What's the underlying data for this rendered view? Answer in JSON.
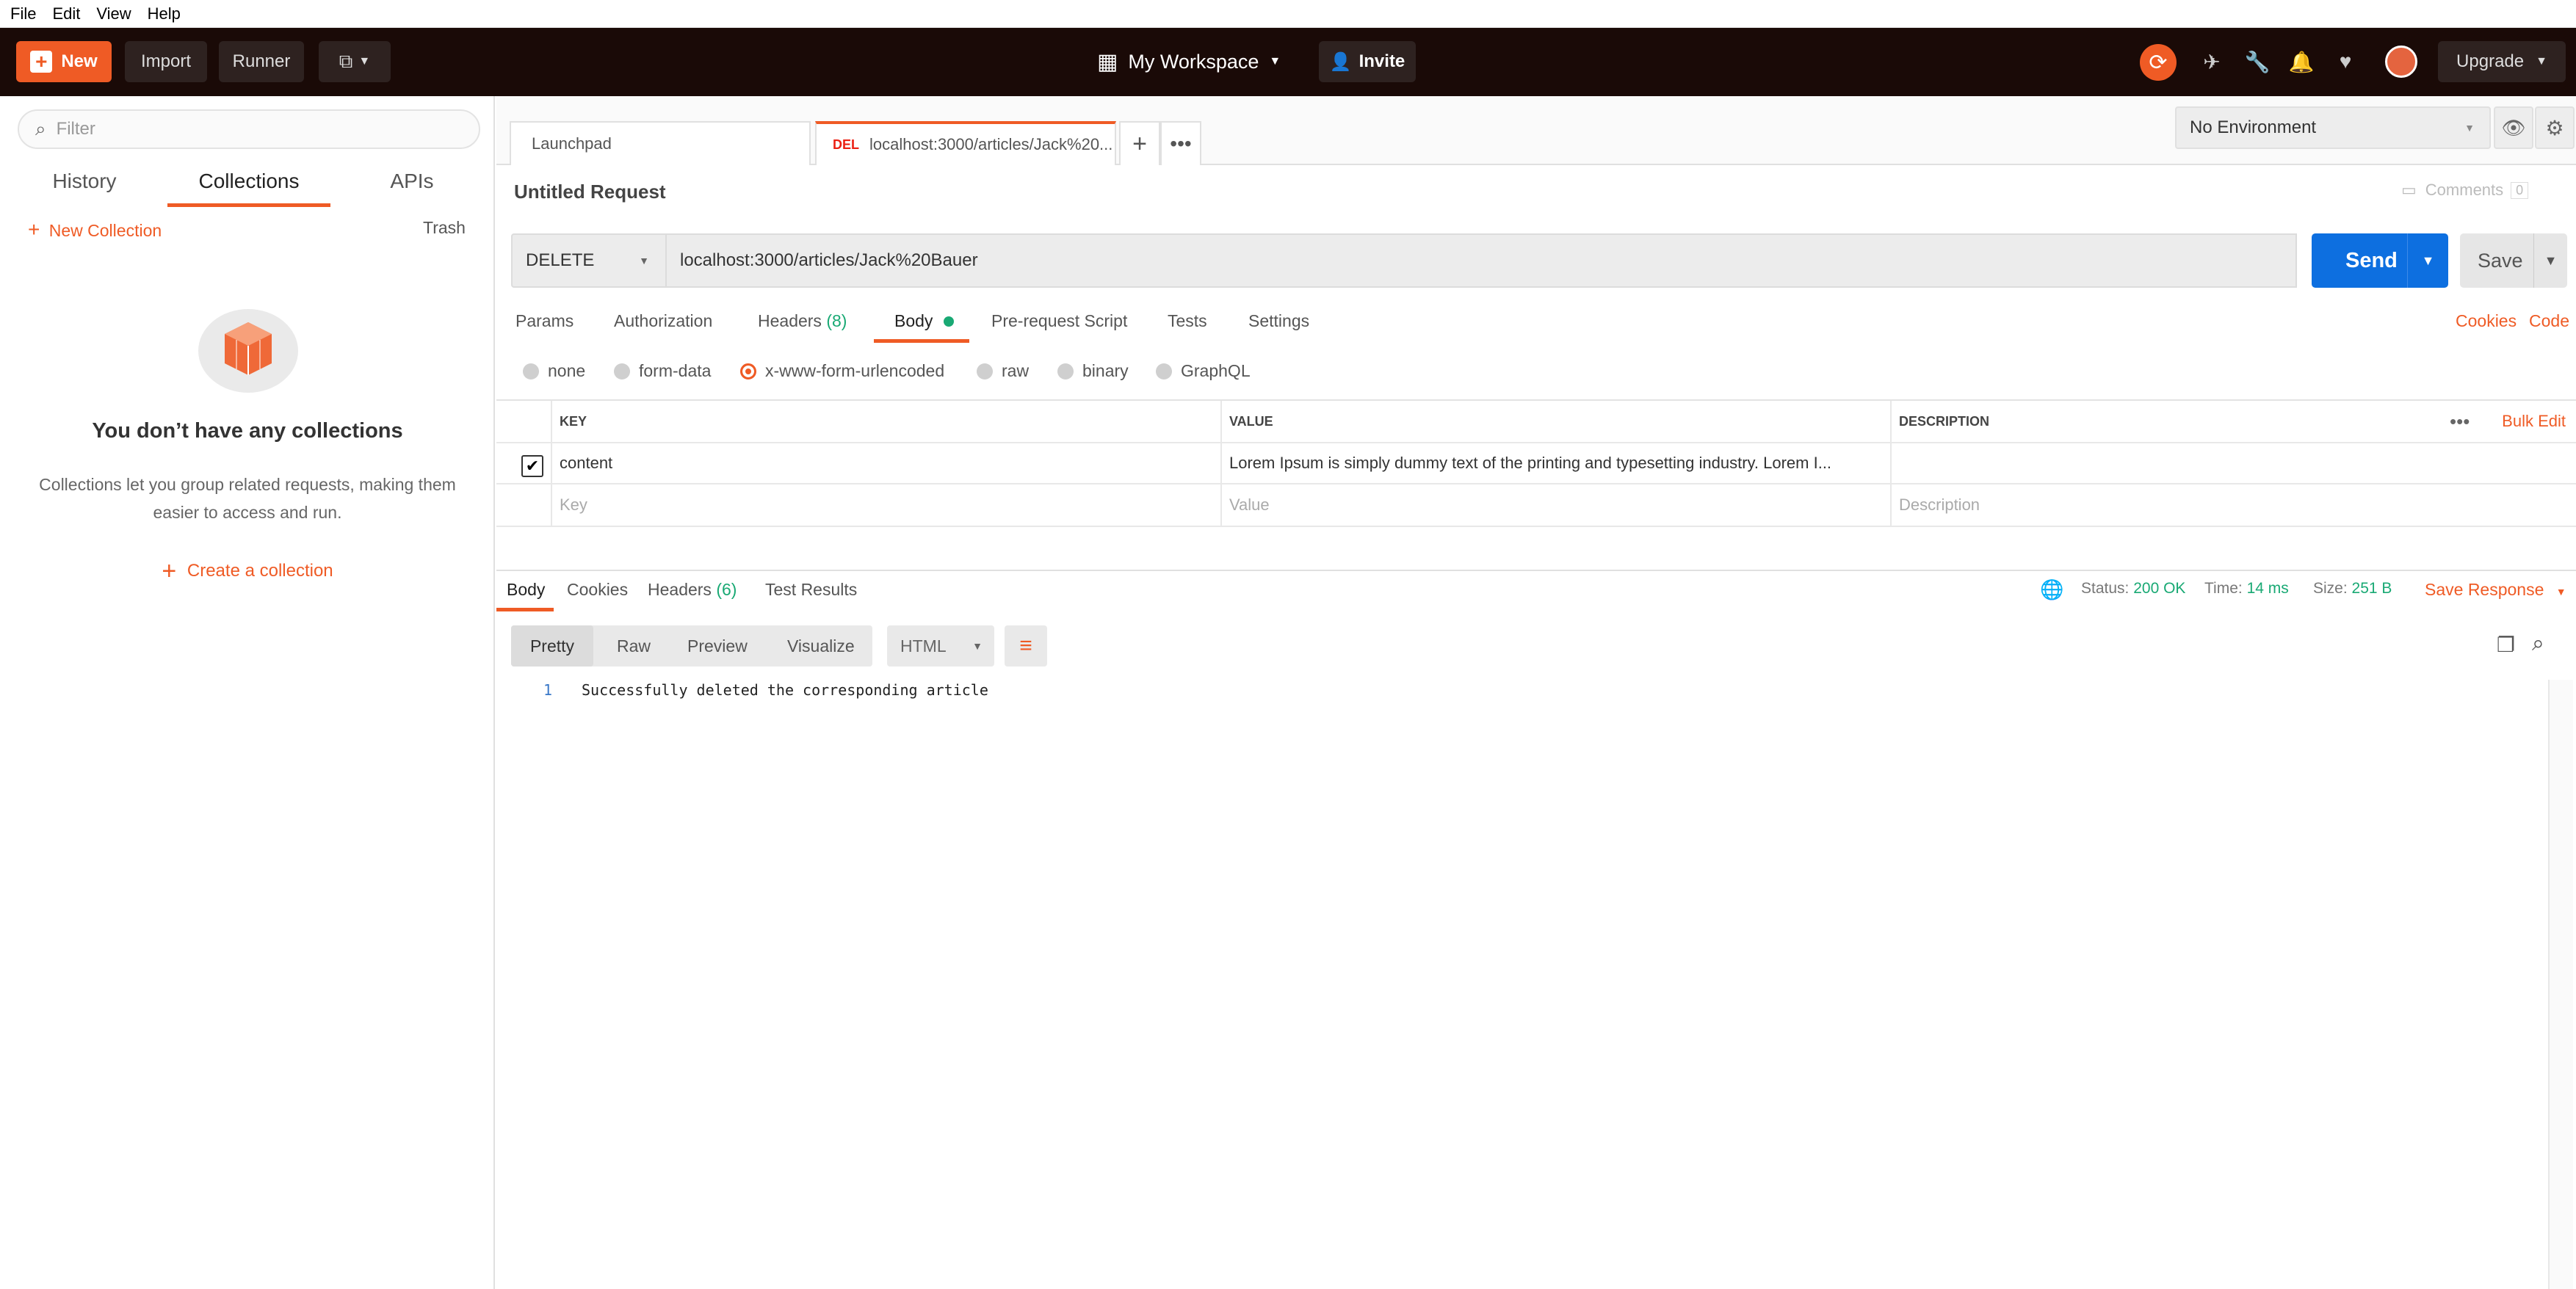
{
  "menu": [
    "File",
    "Edit",
    "View",
    "Help"
  ],
  "header": {
    "new_label": "New",
    "import_label": "Import",
    "runner_label": "Runner",
    "workspace_label": "My Workspace",
    "invite_label": "Invite",
    "upgrade_label": "Upgrade"
  },
  "sidebar": {
    "filter_placeholder": "Filter",
    "tabs": [
      "History",
      "Collections",
      "APIs"
    ],
    "active_tab": "Collections",
    "new_collection_label": "New Collection",
    "trash_label": "Trash",
    "empty_title": "You don’t have any collections",
    "empty_desc": "Collections let you group related requests, making them easier to access and run.",
    "create_label": "Create a collection"
  },
  "tabs": {
    "launchpad": "Launchpad",
    "request_method": "DEL",
    "request_label": "localhost:3000/articles/Jack%20..."
  },
  "environment": {
    "selected": "No Environment"
  },
  "request": {
    "title": "Untitled Request",
    "comments_label": "Comments",
    "comments_count": "0",
    "method": "DELETE",
    "url": "localhost:3000/articles/Jack%20Bauer",
    "send_label": "Send",
    "save_label": "Save",
    "tabs": {
      "params": "Params",
      "authorization": "Authorization",
      "headers": "Headers",
      "headers_count": "(8)",
      "body": "Body",
      "prerequest": "Pre-request Script",
      "tests": "Tests",
      "settings": "Settings"
    },
    "cookies_label": "Cookies",
    "code_label": "Code",
    "body_types": [
      "none",
      "form-data",
      "x-www-form-urlencoded",
      "raw",
      "binary",
      "GraphQL"
    ],
    "body_type_selected": "x-www-form-urlencoded",
    "table": {
      "headers": [
        "KEY",
        "VALUE",
        "DESCRIPTION"
      ],
      "bulk_edit": "Bulk Edit",
      "rows": [
        {
          "checked": true,
          "key": "content",
          "value": "Lorem Ipsum is simply dummy text of the printing and typesetting industry. Lorem I...",
          "description": ""
        }
      ],
      "placeholder": {
        "key": "Key",
        "value": "Value",
        "description": "Description"
      }
    }
  },
  "response": {
    "tabs": {
      "body": "Body",
      "cookies": "Cookies",
      "headers": "Headers",
      "headers_count": "(6)",
      "test_results": "Test Results"
    },
    "status_label": "Status:",
    "status_value": "200 OK",
    "time_label": "Time:",
    "time_value": "14 ms",
    "size_label": "Size:",
    "size_value": "251 B",
    "save_response_label": "Save Response",
    "views": [
      "Pretty",
      "Raw",
      "Preview",
      "Visualize"
    ],
    "format": "HTML",
    "line_number": "1",
    "content": "Successfully deleted the corresponding article"
  },
  "colors": {
    "accent": "#ef5b25",
    "header_bg": "#1a0a07",
    "send_blue": "#0d6fe0",
    "success_green": "#19a974",
    "delete_red": "#eb2013"
  }
}
